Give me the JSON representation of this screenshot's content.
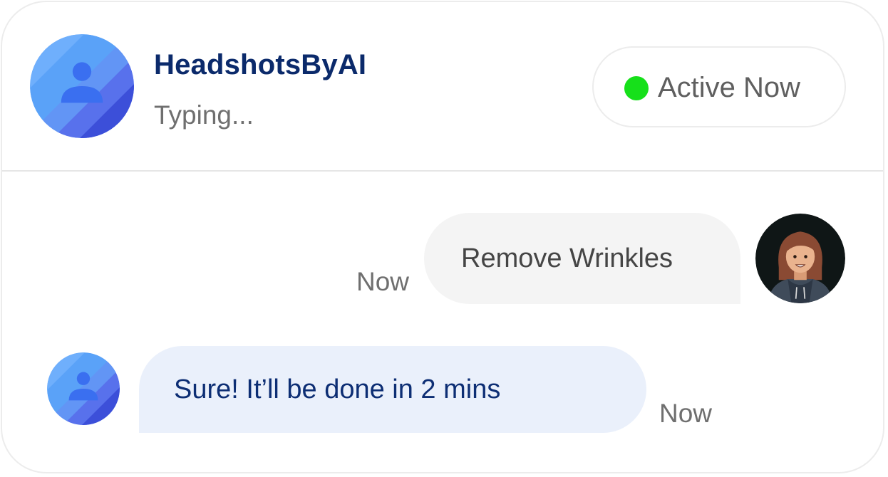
{
  "header": {
    "bot_name": "HeadshotsByAI",
    "status": "Typing...",
    "active_label": "Active Now",
    "active_color": "#16e01a",
    "bot_avatar_icon": "person-icon"
  },
  "messages": [
    {
      "sender": "user",
      "text": "Remove Wrinkles",
      "time": "Now",
      "avatar_icon": "user-avatar-woman"
    },
    {
      "sender": "bot",
      "text": "Sure! It’ll be done in 2 mins",
      "time": "Now",
      "avatar_icon": "person-icon"
    }
  ],
  "colors": {
    "brand_dark_blue": "#0b2a6b",
    "bot_bubble_bg": "#eaf0fb",
    "user_bubble_bg": "#f4f4f4"
  }
}
